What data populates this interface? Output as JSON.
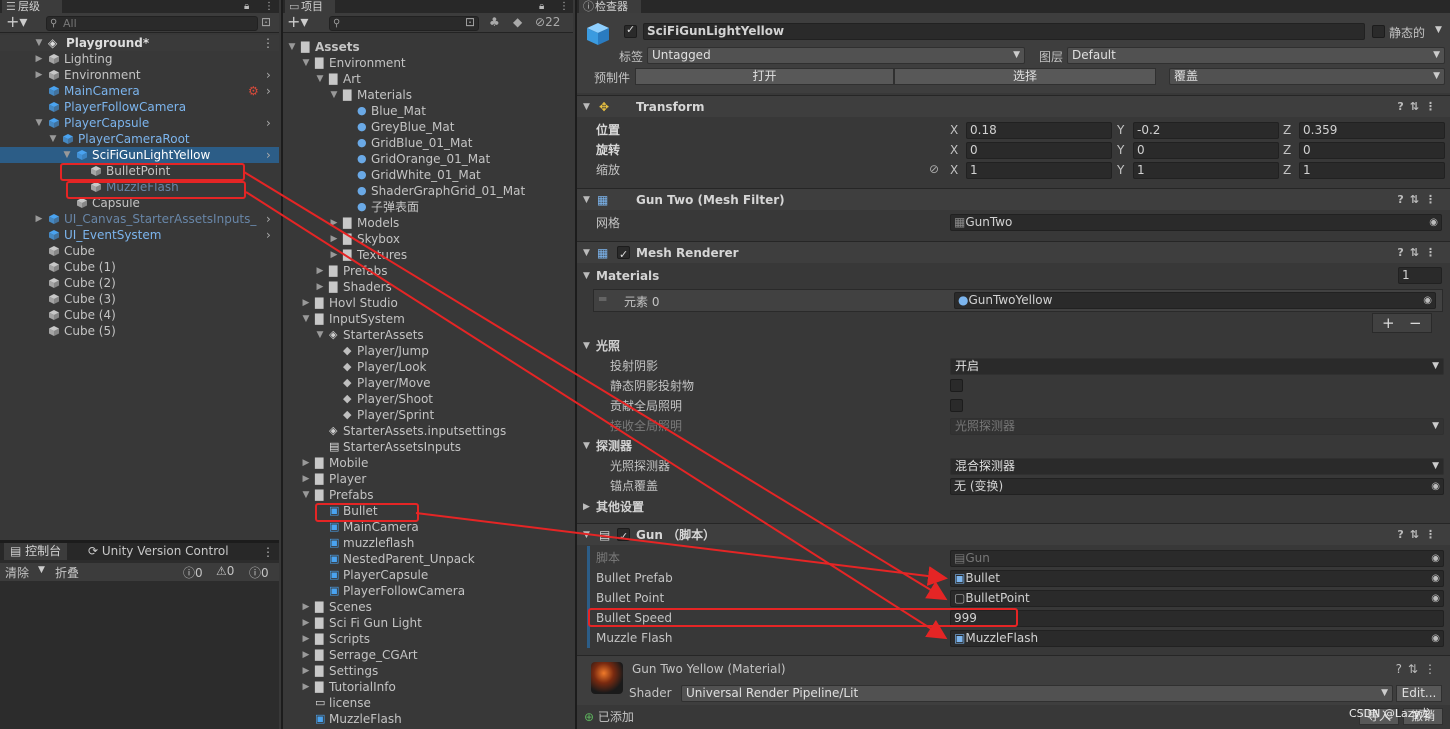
{
  "hierarchy": {
    "tab": "层级",
    "search_placeholder": "All",
    "scene": "Playground*",
    "items": [
      {
        "label": "Lighting"
      },
      {
        "label": "Environment"
      },
      {
        "label": "MainCamera"
      },
      {
        "label": "PlayerFollowCamera"
      },
      {
        "label": "PlayerCapsule"
      },
      {
        "label": "PlayerCameraRoot"
      },
      {
        "label": "SciFiGunLightYellow"
      },
      {
        "label": "BulletPoint"
      },
      {
        "label": "MuzzleFlash"
      },
      {
        "label": "Capsule"
      },
      {
        "label": "UI_Canvas_StarterAssetsInputs_"
      },
      {
        "label": "UI_EventSystem"
      },
      {
        "label": "Cube"
      },
      {
        "label": "Cube (1)"
      },
      {
        "label": "Cube (2)"
      },
      {
        "label": "Cube (3)"
      },
      {
        "label": "Cube (4)"
      },
      {
        "label": "Cube (5)"
      }
    ]
  },
  "console": {
    "tab": "控制台",
    "tab2": "Unity Version Control",
    "clear": "清除",
    "collapse": "折叠",
    "count_info": "0",
    "count_warn": "0",
    "count_err": "0"
  },
  "project": {
    "tab": "项目",
    "hidden_count": "22",
    "items": [
      {
        "label": "Assets"
      },
      {
        "label": "Environment"
      },
      {
        "label": "Art"
      },
      {
        "label": "Materials"
      },
      {
        "label": "Blue_Mat"
      },
      {
        "label": "GreyBlue_Mat"
      },
      {
        "label": "GridBlue_01_Mat"
      },
      {
        "label": "GridOrange_01_Mat"
      },
      {
        "label": "GridWhite_01_Mat"
      },
      {
        "label": "ShaderGraphGrid_01_Mat"
      },
      {
        "label": "子弹表面"
      },
      {
        "label": "Models"
      },
      {
        "label": "Skybox"
      },
      {
        "label": "Textures"
      },
      {
        "label": "Prefabs"
      },
      {
        "label": "Shaders"
      },
      {
        "label": "Hovl Studio"
      },
      {
        "label": "InputSystem"
      },
      {
        "label": "StarterAssets"
      },
      {
        "label": "Player/Jump"
      },
      {
        "label": "Player/Look"
      },
      {
        "label": "Player/Move"
      },
      {
        "label": "Player/Shoot"
      },
      {
        "label": "Player/Sprint"
      },
      {
        "label": "StarterAssets.inputsettings"
      },
      {
        "label": "StarterAssetsInputs"
      },
      {
        "label": "Mobile"
      },
      {
        "label": "Player"
      },
      {
        "label": "Prefabs"
      },
      {
        "label": "Bullet"
      },
      {
        "label": "MainCamera"
      },
      {
        "label": "muzzleflash"
      },
      {
        "label": "NestedParent_Unpack"
      },
      {
        "label": "PlayerCapsule"
      },
      {
        "label": "PlayerFollowCamera"
      },
      {
        "label": "Scenes"
      },
      {
        "label": "Sci Fi Gun Light"
      },
      {
        "label": "Scripts"
      },
      {
        "label": "Serrage_CGArt"
      },
      {
        "label": "Settings"
      },
      {
        "label": "TutorialInfo"
      },
      {
        "label": "license"
      },
      {
        "label": "MuzzleFlash"
      }
    ]
  },
  "inspector": {
    "tab": "检查器",
    "object_name": "SciFiGunLightYellow",
    "static_label": "静态的",
    "tag_label": "标签",
    "tag_value": "Untagged",
    "layer_label": "图层",
    "layer_value": "Default",
    "prefab_label": "预制件",
    "open": "打开",
    "select": "选择",
    "override": "覆盖",
    "transform": {
      "title": "Transform",
      "position_label": "位置",
      "rotation_label": "旋转",
      "scale_label": "缩放",
      "position": {
        "x": "0.18",
        "y": "-0.2",
        "z": "0.359"
      },
      "rotation": {
        "x": "0",
        "y": "0",
        "z": "0"
      },
      "scale": {
        "x": "1",
        "y": "1",
        "z": "1"
      },
      "axis_x": "X",
      "axis_y": "Y",
      "axis_z": "Z"
    },
    "mesh_filter": {
      "title": "Gun Two (Mesh Filter)",
      "mesh_label": "网格",
      "mesh_value": "GunTwo"
    },
    "mesh_renderer": {
      "title": "Mesh Renderer",
      "materials_label": "Materials",
      "materials_count": "1",
      "element_label": "元素 0",
      "element_value": "GunTwoYellow",
      "plus": "+",
      "minus": "−",
      "lighting": "光照",
      "cast_shadows": "投射阴影",
      "cast_shadows_value": "开启",
      "static_shadow": "静态阴影投射物",
      "contribute_gi": "贡献全局照明",
      "receive_gi": "接收全局照明",
      "receive_gi_value": "光照探测器",
      "probes": "探测器",
      "light_probes": "光照探测器",
      "light_probes_value": "混合探测器",
      "anchor": "锚点覆盖",
      "anchor_value": "无 (变换)",
      "other": "其他设置"
    },
    "gun": {
      "title": "Gun （脚本）",
      "script_label": "脚本",
      "script_value": "Gun",
      "bullet_prefab_label": "Bullet Prefab",
      "bullet_prefab_value": "Bullet",
      "bullet_point_label": "Bullet Point",
      "bullet_point_value": "BulletPoint",
      "bullet_speed_label": "Bullet Speed",
      "bullet_speed_value": "999",
      "muzzle_label": "Muzzle Flash",
      "muzzle_value": "MuzzleFlash"
    },
    "material": {
      "title": "Gun Two Yellow (Material)",
      "shader_label": "Shader",
      "shader_value": "Universal Render Pipeline/Lit",
      "edit": "Edit..."
    },
    "added": "已添加",
    "footer_btn1": "导入",
    "footer_btn2": "撤销",
    "watermark": "CSDN @Lazy龙"
  },
  "colors": {
    "accent": "#2c5d87",
    "annotation": "#e52525",
    "prefab_blue": "#7cb5ee"
  }
}
